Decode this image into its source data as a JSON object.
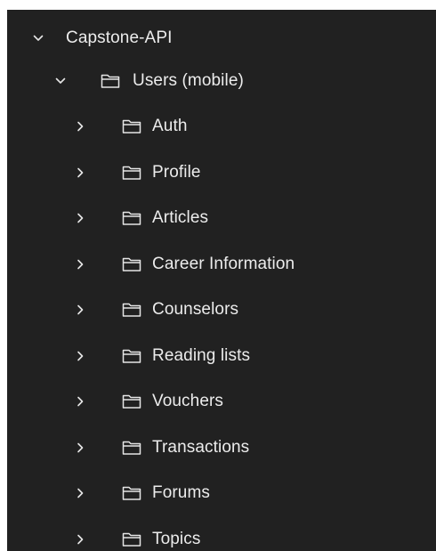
{
  "tree": {
    "root": {
      "label": "Capstone-API",
      "expanded": true,
      "chevron_icon": "chevron-down-icon"
    },
    "group": {
      "label": "Users (mobile)",
      "expanded": true,
      "chevron_icon": "chevron-down-icon",
      "folder_icon": "folder-icon"
    },
    "children": [
      {
        "label": "Auth",
        "chevron_icon": "chevron-right-icon",
        "folder_icon": "folder-icon"
      },
      {
        "label": "Profile",
        "chevron_icon": "chevron-right-icon",
        "folder_icon": "folder-icon"
      },
      {
        "label": "Articles",
        "chevron_icon": "chevron-right-icon",
        "folder_icon": "folder-icon"
      },
      {
        "label": "Career Information",
        "chevron_icon": "chevron-right-icon",
        "folder_icon": "folder-icon"
      },
      {
        "label": "Counselors",
        "chevron_icon": "chevron-right-icon",
        "folder_icon": "folder-icon"
      },
      {
        "label": "Reading lists",
        "chevron_icon": "chevron-right-icon",
        "folder_icon": "folder-icon"
      },
      {
        "label": "Vouchers",
        "chevron_icon": "chevron-right-icon",
        "folder_icon": "folder-icon"
      },
      {
        "label": "Transactions",
        "chevron_icon": "chevron-right-icon",
        "folder_icon": "folder-icon"
      },
      {
        "label": "Forums",
        "chevron_icon": "chevron-right-icon",
        "folder_icon": "folder-icon"
      },
      {
        "label": "Topics",
        "chevron_icon": "chevron-right-icon",
        "folder_icon": "folder-icon"
      }
    ]
  },
  "colors": {
    "panel_background": "#212121",
    "text": "#ececec",
    "icon_stroke": "#e6e6e6"
  }
}
